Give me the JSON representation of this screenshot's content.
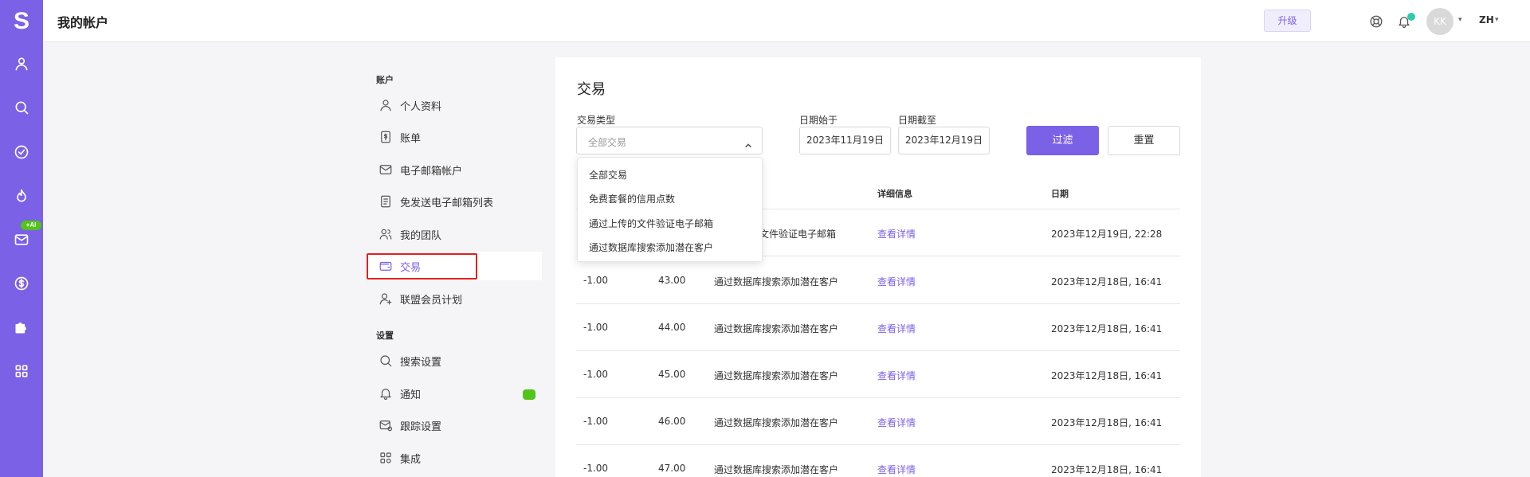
{
  "header": {
    "title": "我的帐户",
    "upgrade_label": "升级",
    "avatar_initials": "KK",
    "language": "ZH"
  },
  "rail": {
    "logo": "S",
    "ai_badge": "+AI",
    "icons": [
      "user-icon",
      "search-icon",
      "check-circle-icon",
      "fire-icon",
      "mail-icon",
      "dollar-circle-icon",
      "puzzle-icon",
      "apps-grid-icon"
    ]
  },
  "sidenav": {
    "account_label": "账户",
    "settings_label": "设置",
    "account_items": [
      {
        "label": "个人资料",
        "icon": "user-icon"
      },
      {
        "label": "账单",
        "icon": "dollar-file-icon"
      },
      {
        "label": "电子邮箱帐户",
        "icon": "mail-icon"
      },
      {
        "label": "免发送电子邮箱列表",
        "icon": "list-file-icon"
      },
      {
        "label": "我的团队",
        "icon": "team-icon"
      },
      {
        "label": "交易",
        "icon": "wallet-icon"
      },
      {
        "label": "联盟会员计划",
        "icon": "user-plus-icon"
      }
    ],
    "settings_items": [
      {
        "label": "搜索设置",
        "icon": "search-icon"
      },
      {
        "label": "通知",
        "icon": "bell-icon"
      },
      {
        "label": "跟踪设置",
        "icon": "mail-settings-icon"
      },
      {
        "label": "集成",
        "icon": "integration-icon"
      }
    ]
  },
  "main": {
    "title": "交易",
    "filters": {
      "type_label": "交易类型",
      "type_value": "全部交易",
      "date_from_label": "日期始于",
      "date_from_value": "2023年11月19日",
      "date_to_label": "日期截至",
      "date_to_value": "2023年12月19日",
      "filter_button": "过滤",
      "reset_button": "重置"
    },
    "dropdown_options": [
      "全部交易",
      "免费套餐的信用点数",
      "通过上传的文件验证电子邮箱",
      "通过数据库搜索添加潜在客户"
    ],
    "table": {
      "headers": {
        "details": "详细信息",
        "date": "日期"
      },
      "rows": [
        {
          "amount": "",
          "balance": "",
          "description": "文件验证电子邮箱",
          "details": "查看详情",
          "date": "2023年12月19日, 22:28"
        },
        {
          "amount": "-1.00",
          "balance": "43.00",
          "description": "通过数据库搜索添加潜在客户",
          "details": "查看详情",
          "date": "2023年12月18日, 16:41"
        },
        {
          "amount": "-1.00",
          "balance": "44.00",
          "description": "通过数据库搜索添加潜在客户",
          "details": "查看详情",
          "date": "2023年12月18日, 16:41"
        },
        {
          "amount": "-1.00",
          "balance": "45.00",
          "description": "通过数据库搜索添加潜在客户",
          "details": "查看详情",
          "date": "2023年12月18日, 16:41"
        },
        {
          "amount": "-1.00",
          "balance": "46.00",
          "description": "通过数据库搜索添加潜在客户",
          "details": "查看详情",
          "date": "2023年12月18日, 16:41"
        },
        {
          "amount": "-1.00",
          "balance": "47.00",
          "description": "通过数据库搜索添加潜在客户",
          "details": "查看详情",
          "date": "2023年12月18日, 16:41"
        }
      ]
    }
  },
  "colors": {
    "accent": "#7b61e6",
    "highlight": "#e02020",
    "success": "#52c41a"
  }
}
